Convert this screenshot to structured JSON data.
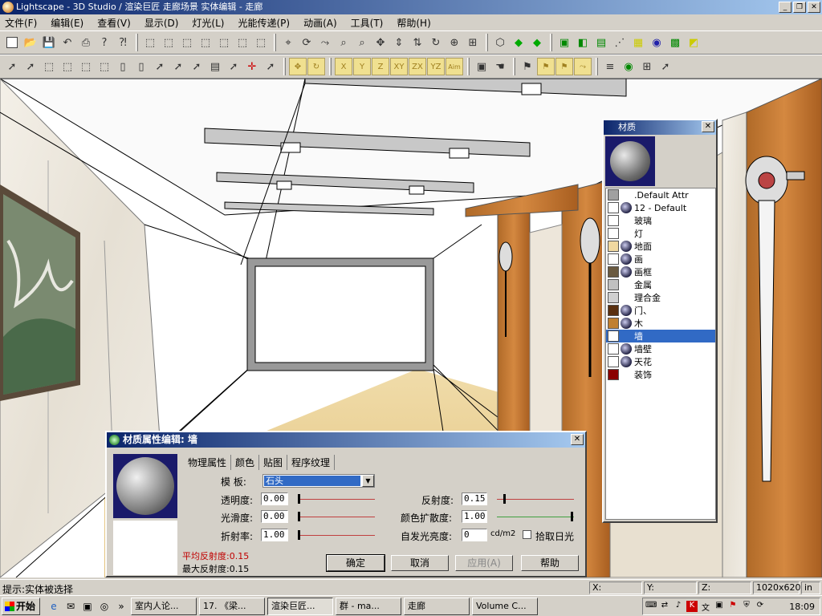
{
  "window": {
    "title": "Lightscape - 3D Studio / 渲染巨匠 走廊场景 实体编辑 - 走廊"
  },
  "menu": [
    "文件(F)",
    "编辑(E)",
    "查看(V)",
    "显示(D)",
    "灯光(L)",
    "光能传递(P)",
    "动画(A)",
    "工具(T)",
    "帮助(H)"
  ],
  "toolbar2": {
    "axis_labels": [
      "X",
      "Y",
      "Z",
      "XY",
      "ZX",
      "YZ",
      "Aim"
    ]
  },
  "material_panel": {
    "title": "材质",
    "items": [
      {
        "name": ".Default Attr",
        "color": "#a0a0a0",
        "globe": false
      },
      {
        "name": "12 - Default",
        "color": "#ffffff",
        "globe": true
      },
      {
        "name": "玻璃",
        "color": "#ffffff",
        "globe": false
      },
      {
        "name": "灯",
        "color": "#ffffff",
        "globe": false
      },
      {
        "name": "地面",
        "color": "#f0d8a0",
        "globe": true
      },
      {
        "name": "画",
        "color": "#ffffff",
        "globe": true
      },
      {
        "name": "画框",
        "color": "#6a5a40",
        "globe": true
      },
      {
        "name": "金属",
        "color": "#c0c0c0",
        "globe": false
      },
      {
        "name": "理合金",
        "color": "#d0d0d0",
        "globe": false
      },
      {
        "name": "门、",
        "color": "#5a3010",
        "globe": true
      },
      {
        "name": "木",
        "color": "#c08030",
        "globe": true
      },
      {
        "name": "墙",
        "color": "#ffffff",
        "globe": false,
        "selected": true
      },
      {
        "name": "墙壁",
        "color": "#ffffff",
        "globe": true
      },
      {
        "name": "天花",
        "color": "#ffffff",
        "globe": true
      },
      {
        "name": "装饰",
        "color": "#8a0000",
        "globe": false
      }
    ]
  },
  "dialog": {
    "title": "材质属性编辑: 墙",
    "tabs": [
      "物理属性",
      "颜色",
      "贴图",
      "程序纹理"
    ],
    "template_label": "模  板:",
    "template_value": "石头",
    "transparency_label": "透明度:",
    "transparency_value": "0.00",
    "smoothness_label": "光滑度:",
    "smoothness_value": "0.00",
    "refraction_label": "折射率:",
    "refraction_value": "1.00",
    "reflectance_label": "反射度:",
    "reflectance_value": "0.15",
    "color_bleed_label": "颜色扩散度:",
    "color_bleed_value": "1.00",
    "luminance_label": "自发光亮度:",
    "luminance_value": "0",
    "luminance_unit": "cd/m2",
    "daylight_label": "拾取日光",
    "avg_reflectance": "平均反射度:0.15",
    "max_reflectance": "最大反射度:0.15",
    "ok": "确定",
    "cancel": "取消",
    "apply": "应用(A)",
    "help": "帮助"
  },
  "status": {
    "hint": "提示:实体被选择",
    "x": "X:",
    "y": "Y:",
    "z": "Z:",
    "resolution": "1020x620",
    "unit": "in"
  },
  "taskbar": {
    "start": "开始",
    "tasks": [
      "室内人论...",
      "17. 《梁...",
      "渲染巨匠...",
      "群 - ma...",
      "走廊",
      "Volume C..."
    ],
    "clock": "18:09"
  }
}
